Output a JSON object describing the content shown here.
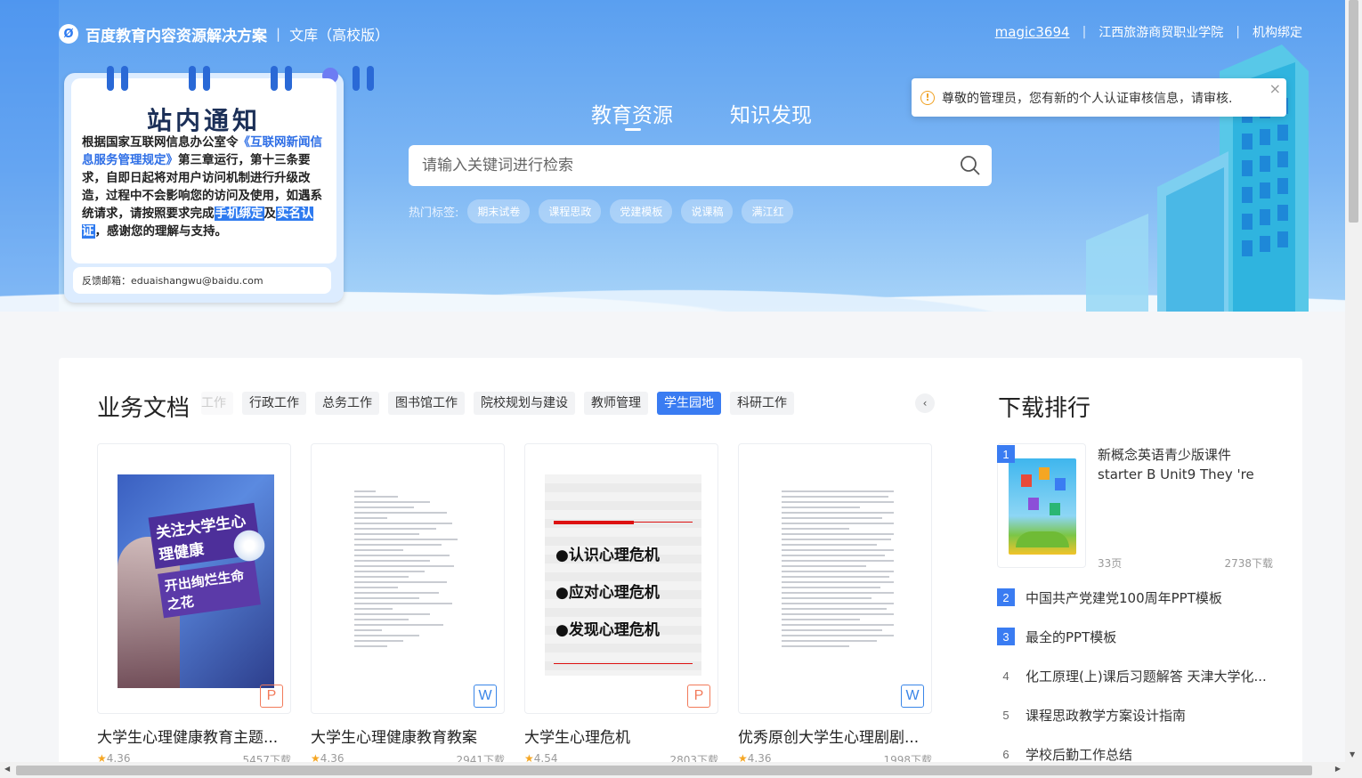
{
  "header": {
    "brand": "百度教育内容资源解决方案",
    "sep": "|",
    "subtitle": "文库（高校版）",
    "user": "magic3694",
    "school": "江西旅游商贸职业学院",
    "org_bind": "机构绑定"
  },
  "notice": {
    "title": "站内通知",
    "body_1": "根据国家互联网信息办公室令",
    "body_link": "《互联网新闻信息服务管理规定》",
    "body_2": "第三章运行，第十三条要求，自即日起将对用户访问机制进行升级改造，过程中不会影响您的访问及使用，如遇系统请求，请按照要求完成",
    "phone_bind": "手机绑定",
    "and": "及",
    "realname": "实名认证",
    "body_3": "，感谢您的理解与支持。",
    "mail": "反馈邮箱：eduaishangwu@baidu.com"
  },
  "hero": {
    "tabs": [
      "教育资源",
      "知识发现"
    ],
    "search_placeholder": "请输入关键词进行检索",
    "hot_label": "热门标签:",
    "hot_tags": [
      "期末试卷",
      "课程思政",
      "党建模板",
      "说课稿",
      "满江红"
    ]
  },
  "toast": {
    "text": "尊敬的管理员，您有新的个人认证审核信息，请审核.",
    "close": "×"
  },
  "business": {
    "title": "业务文档",
    "categories": [
      "工作",
      "行政工作",
      "总务工作",
      "图书馆工作",
      "院校规划与建设",
      "教师管理",
      "学生园地",
      "科研工作"
    ],
    "cards": [
      {
        "title": "大学生心理健康教育主题...",
        "rating": "4.36",
        "downloads": "5457下载",
        "type": "P",
        "cover_line1": "关注大学生心理健康",
        "cover_line2": "开出绚烂生命之花"
      },
      {
        "title": "大学生心理健康教育教案",
        "rating": "4.36",
        "downloads": "2941下载",
        "type": "W"
      },
      {
        "title": "大学生心理危机",
        "rating": "4.54",
        "downloads": "2803下载",
        "type": "P",
        "bullets": [
          "●认识心理危机",
          "●应对心理危机",
          "●发现心理危机"
        ]
      },
      {
        "title": "优秀原创大学生心理剧剧...",
        "rating": "4.36",
        "downloads": "1998下载",
        "type": "W"
      }
    ]
  },
  "ranking": {
    "title": "下载排行",
    "top": {
      "num": "1",
      "title": "新概念英语青少版课件starter B Unit9 They 're",
      "pages": "33页",
      "downloads": "2738下载"
    },
    "items": [
      {
        "num": "2",
        "title": "中国共产党建党100周年PPT模板"
      },
      {
        "num": "3",
        "title": "最全的PPT模板"
      },
      {
        "num": "4",
        "title": "化工原理(上)课后习题解答 天津大学化..."
      },
      {
        "num": "5",
        "title": "课程思政教学方案设计指南"
      },
      {
        "num": "6",
        "title": "学校后勤工作总结"
      }
    ]
  },
  "colors": {
    "accent": "#3a7cf2",
    "hero_top": "#5a9ff0",
    "ppt_badge": "#f27a5a",
    "doc_badge": "#3a86e8",
    "star": "#f5a623"
  }
}
